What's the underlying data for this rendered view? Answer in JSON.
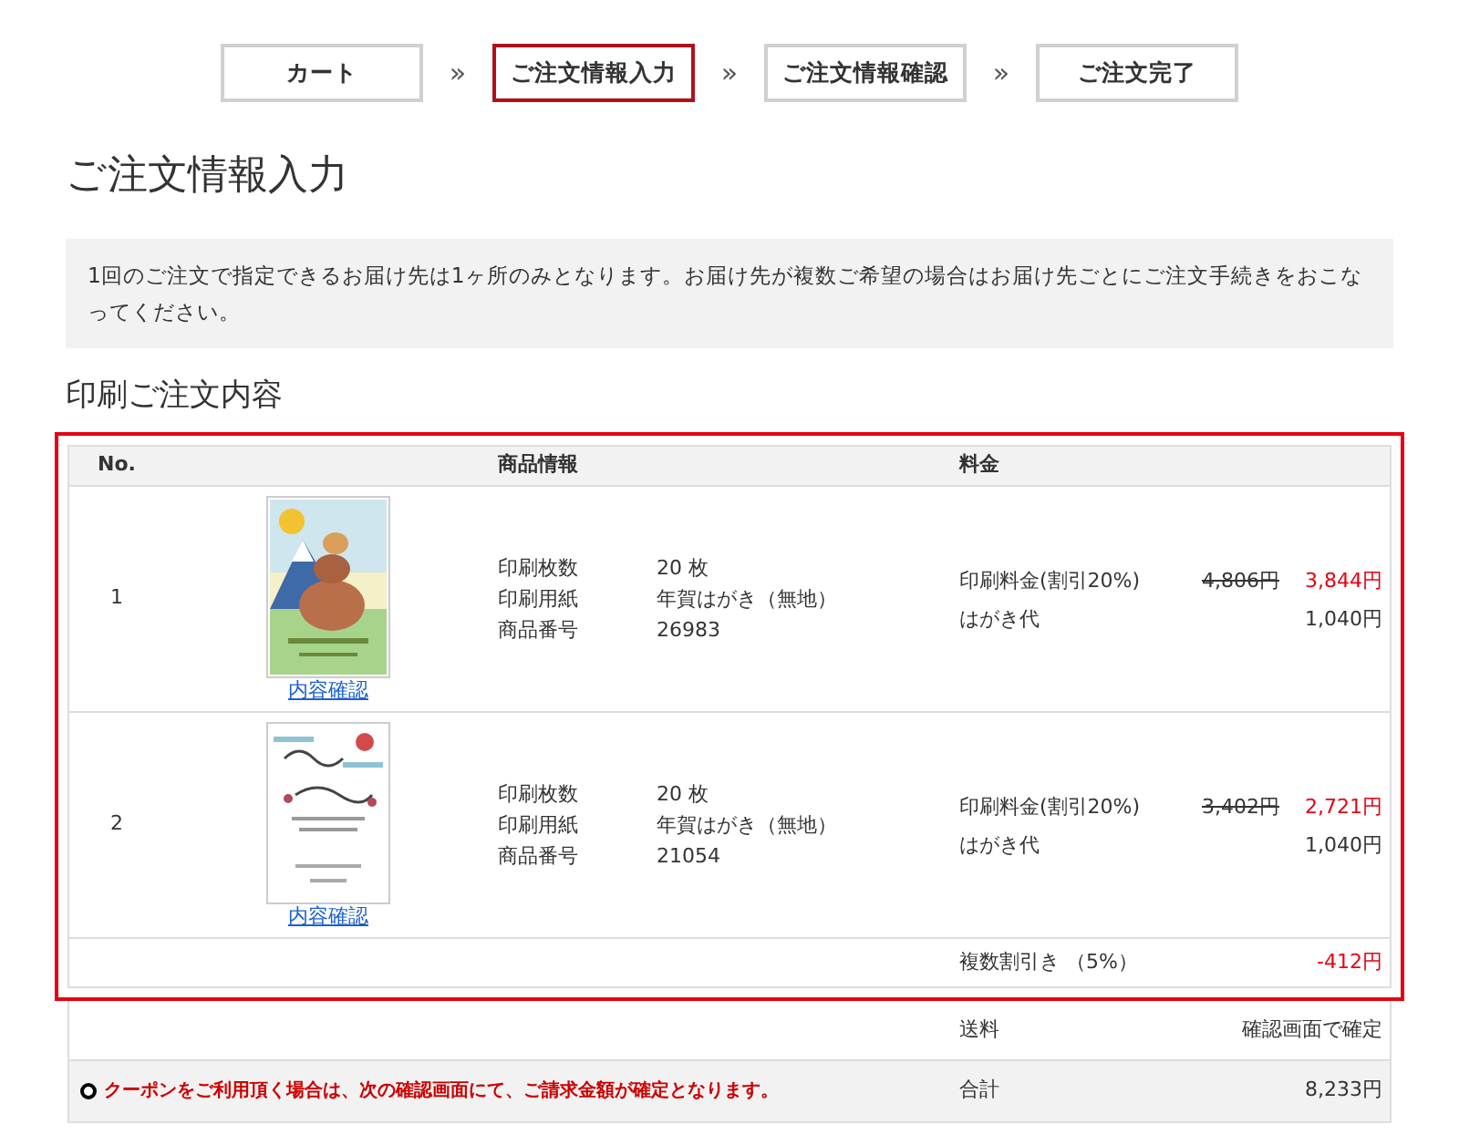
{
  "steps": [
    {
      "label": "カート",
      "selected": false
    },
    {
      "label": "ご注文情報入力",
      "selected": true
    },
    {
      "label": "ご注文情報確認",
      "selected": false
    },
    {
      "label": "ご注文完了",
      "selected": false
    }
  ],
  "step_separators": [
    "»",
    "»",
    "»"
  ],
  "page_title": "ご注文情報入力",
  "notice": "1回のご注文で指定できるお届け先は1ヶ所のみとなります。お届け先が複数ご希望の場合はお届け先ごとにご注文手続きをおこなってください。",
  "section_title": "印刷ご注文内容",
  "table": {
    "columns": [
      "No.",
      "商品情報",
      "料金"
    ],
    "rows": [
      {
        "no": "1",
        "picture": {
          "kind": "picture"
        },
        "link": "内容確認",
        "details": [
          {
            "label": "印刷枚数",
            "value": "20 枚"
          },
          {
            "label": "印刷用紙",
            "value": "年賀はがき（無地）"
          },
          {
            "label": "商品番号",
            "value": "26983"
          }
        ],
        "prices": [
          {
            "label": "印刷料金(割引20%)",
            "original": "4,806円",
            "price": "3,844円",
            "discounted": true
          },
          {
            "label": "はがき代",
            "price": "1,040円",
            "discounted": false
          }
        ]
      },
      {
        "no": "2",
        "picture": {
          "kind": "picture"
        },
        "link": "内容確認",
        "details": [
          {
            "label": "印刷枚数",
            "value": "20 枚"
          },
          {
            "label": "印刷用紙",
            "value": "年賀はがき（無地）"
          },
          {
            "label": "商品番号",
            "value": "21054"
          }
        ],
        "prices": [
          {
            "label": "印刷料金(割引20%)",
            "original": "3,402円",
            "price": "2,721円",
            "discounted": true
          },
          {
            "label": "はがき代",
            "price": "1,040円",
            "discounted": false
          }
        ]
      }
    ],
    "discount": {
      "label": "複数割引き （5%）",
      "value": "-412円"
    }
  },
  "shipping": {
    "label": "送料",
    "value": "確認画面で確定"
  },
  "total": {
    "notice": "クーポンをご利用頂く場合は、次の確認画面にて、ご請求金額が確定となります。",
    "label": "合計",
    "value": "8,233円"
  }
}
